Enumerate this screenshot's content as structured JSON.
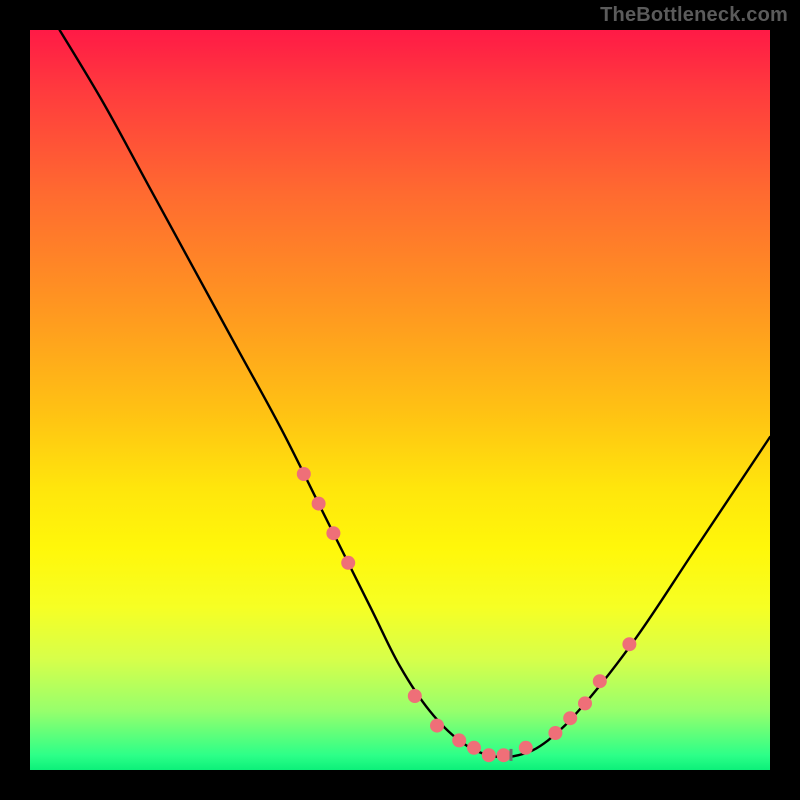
{
  "watermark": "TheBottleneck.com",
  "chart_data": {
    "type": "line",
    "title": "",
    "xlabel": "",
    "ylabel": "",
    "xlim": [
      0,
      100
    ],
    "ylim": [
      0,
      100
    ],
    "grid": false,
    "legend": false,
    "series": [
      {
        "name": "bottleneck-curve",
        "x": [
          4,
          10,
          16,
          22,
          28,
          34,
          40,
          46,
          50,
          54,
          58,
          62,
          66,
          70,
          75,
          82,
          90,
          100
        ],
        "y": [
          100,
          90,
          79,
          68,
          57,
          46,
          34,
          22,
          14,
          8,
          4,
          2,
          2,
          4,
          9,
          18,
          30,
          45
        ]
      }
    ],
    "markers": {
      "name": "highlighted-points",
      "color": "#ef6f78",
      "radius": 7,
      "x": [
        37,
        39,
        41,
        43,
        52,
        55,
        58,
        60,
        62,
        64,
        67,
        71,
        73,
        75,
        77,
        81
      ],
      "y": [
        40,
        36,
        32,
        28,
        10,
        6,
        4,
        3,
        2,
        2,
        3,
        5,
        7,
        9,
        12,
        17
      ]
    },
    "accent_tick": {
      "x": 65,
      "y": 1.5
    },
    "colors": {
      "gradient_top": "#ff1a46",
      "gradient_mid": "#ffe60c",
      "gradient_bottom": "#0cf07a",
      "curve": "#000000",
      "marker": "#ef6f78",
      "frame": "#000000",
      "watermark": "#5b5b5b"
    }
  }
}
